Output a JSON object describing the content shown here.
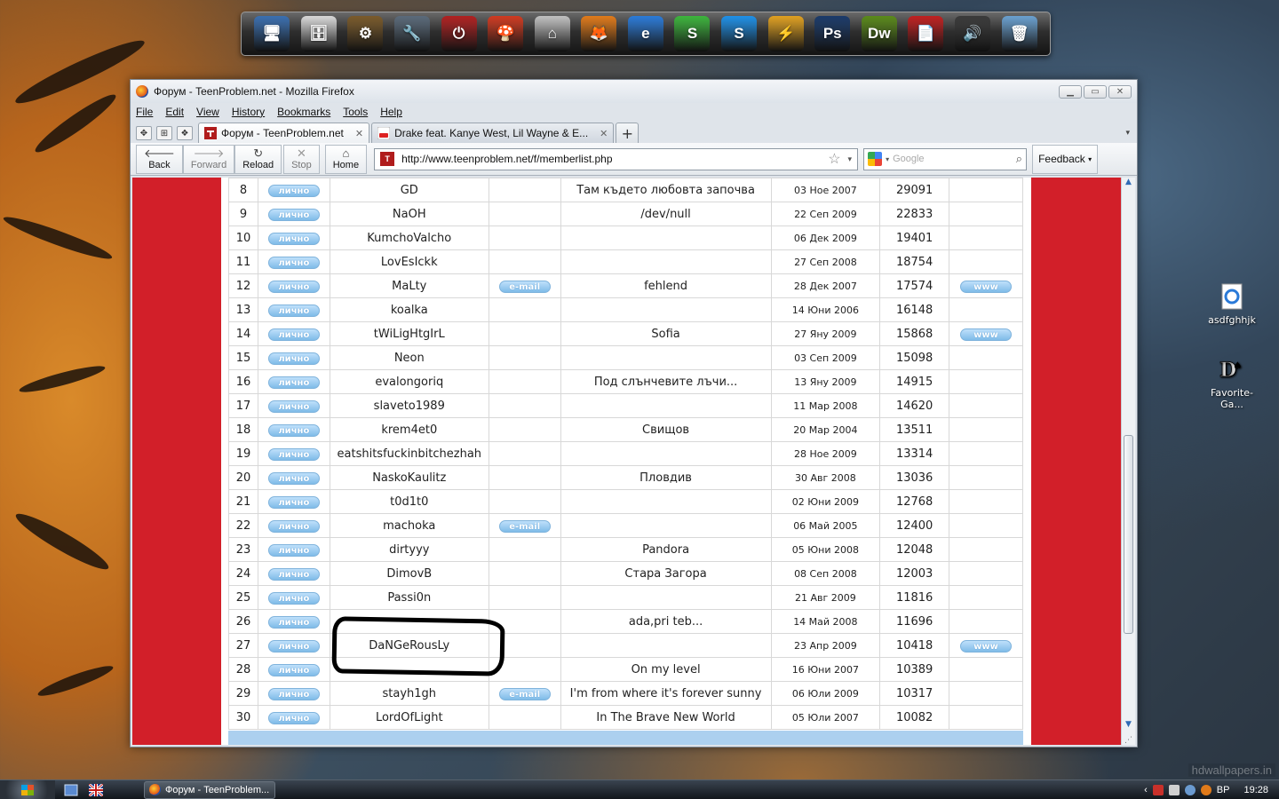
{
  "desktop": {
    "icons": [
      {
        "label": "asdfghhjk"
      },
      {
        "label": "Favorite-Ga..."
      }
    ],
    "watermark": "hdwallpapers.in"
  },
  "dock": {
    "items": [
      {
        "name": "computer-icon",
        "glyph": "🖥",
        "color": "#3a6fb0"
      },
      {
        "name": "file-cabinet-icon",
        "glyph": "🗄",
        "color": "#d8d8d8"
      },
      {
        "name": "tools-icon",
        "glyph": "⚙",
        "color": "#7a5a2a"
      },
      {
        "name": "network-icon",
        "glyph": "🔧",
        "color": "#5a6a7a"
      },
      {
        "name": "switch-icon",
        "glyph": "⏻",
        "color": "#b02020"
      },
      {
        "name": "mushroom-icon",
        "glyph": "🍄",
        "color": "#d03a20"
      },
      {
        "name": "house-icon",
        "glyph": "⌂",
        "color": "#c0c0c0"
      },
      {
        "name": "firefox-icon",
        "glyph": "🦊",
        "color": "#e07a1a"
      },
      {
        "name": "internet-explorer-icon",
        "glyph": "e",
        "color": "#2a7ad8"
      },
      {
        "name": "skype-green-icon",
        "glyph": "S",
        "color": "#3cb43c"
      },
      {
        "name": "skype-icon",
        "glyph": "S",
        "color": "#1e90e8"
      },
      {
        "name": "lightning-icon",
        "glyph": "⚡",
        "color": "#e0a020"
      },
      {
        "name": "photoshop-icon",
        "glyph": "Ps",
        "color": "#1a3a6a"
      },
      {
        "name": "dreamweaver-icon",
        "glyph": "Dw",
        "color": "#5a8a1a"
      },
      {
        "name": "pdf-icon",
        "glyph": "📄",
        "color": "#c02020"
      },
      {
        "name": "speakers-icon",
        "glyph": "🔊",
        "color": "#3a3a3a"
      },
      {
        "name": "recycle-bin-icon",
        "glyph": "🗑",
        "color": "#6aa0d0"
      }
    ]
  },
  "window": {
    "title": "Форум - TeenProblem.net - Mozilla Firefox",
    "menu": [
      "File",
      "Edit",
      "View",
      "History",
      "Bookmarks",
      "Tools",
      "Help"
    ],
    "tabs": [
      {
        "label": "Форум - TeenProblem.net",
        "active": true
      },
      {
        "label": "Drake feat. Kanye West, Lil Wayne & E...",
        "active": false
      }
    ],
    "nav": {
      "back": "Back",
      "forward": "Forward",
      "reload": "Reload",
      "stop": "Stop",
      "home": "Home",
      "feedback": "Feedback"
    },
    "url": "http://www.teenproblem.net/f/memberlist.php",
    "search_placeholder": "Google"
  },
  "members": {
    "pm_label": "лично",
    "email_label": "e-mail",
    "www_label": "www",
    "rows": [
      {
        "rank": "8",
        "user": "GD",
        "email": false,
        "location": "Там където любовта започва",
        "joined": "03 Ное 2007",
        "posts": "29091",
        "www": false
      },
      {
        "rank": "9",
        "user": "NaOH",
        "email": false,
        "location": "/dev/null",
        "joined": "22 Сеп 2009",
        "posts": "22833",
        "www": false
      },
      {
        "rank": "10",
        "user": "KumchoValcho",
        "email": false,
        "location": "",
        "joined": "06 Дек 2009",
        "posts": "19401",
        "www": false
      },
      {
        "rank": "11",
        "user": "LovEsIckk",
        "email": false,
        "location": "",
        "joined": "27 Сеп 2008",
        "posts": "18754",
        "www": false
      },
      {
        "rank": "12",
        "user": "MaLty",
        "email": true,
        "location": "fehlend",
        "joined": "28 Дек 2007",
        "posts": "17574",
        "www": true
      },
      {
        "rank": "13",
        "user": "koalka",
        "email": false,
        "location": "",
        "joined": "14 Юни 2006",
        "posts": "16148",
        "www": false
      },
      {
        "rank": "14",
        "user": "tWiLigHtgIrL",
        "email": false,
        "location": "Sofia",
        "joined": "27 Яну 2009",
        "posts": "15868",
        "www": true
      },
      {
        "rank": "15",
        "user": "Neon",
        "email": false,
        "location": "",
        "joined": "03 Сеп 2009",
        "posts": "15098",
        "www": false
      },
      {
        "rank": "16",
        "user": "evalongoriq",
        "email": false,
        "location": "Под слънчевите лъчи...",
        "joined": "13 Яну 2009",
        "posts": "14915",
        "www": false
      },
      {
        "rank": "17",
        "user": "slaveto1989",
        "email": false,
        "location": "",
        "joined": "11 Мар 2008",
        "posts": "14620",
        "www": false
      },
      {
        "rank": "18",
        "user": "krem4et0",
        "email": false,
        "location": "Свищов",
        "joined": "20 Мар 2004",
        "posts": "13511",
        "www": false
      },
      {
        "rank": "19",
        "user": "eatshitsfuckinbitchezhah",
        "email": false,
        "location": "",
        "joined": "28 Ное 2009",
        "posts": "13314",
        "www": false
      },
      {
        "rank": "20",
        "user": "NaskoKaulitz",
        "email": false,
        "location": "Пловдив",
        "joined": "30 Авг 2008",
        "posts": "13036",
        "www": false
      },
      {
        "rank": "21",
        "user": "t0d1t0",
        "email": false,
        "location": "",
        "joined": "02 Юни 2009",
        "posts": "12768",
        "www": false
      },
      {
        "rank": "22",
        "user": "machoka",
        "email": true,
        "location": "",
        "joined": "06 Май 2005",
        "posts": "12400",
        "www": false
      },
      {
        "rank": "23",
        "user": "dirtyyy",
        "email": false,
        "location": "Pandora",
        "joined": "05 Юни 2008",
        "posts": "12048",
        "www": false
      },
      {
        "rank": "24",
        "user": "DimovB",
        "email": false,
        "location": "Стара Загора",
        "joined": "08 Сеп 2008",
        "posts": "12003",
        "www": false
      },
      {
        "rank": "25",
        "user": "Passi0n",
        "email": false,
        "location": "",
        "joined": "21 Авг 2009",
        "posts": "11816",
        "www": false
      },
      {
        "rank": "26",
        "user": "",
        "email": false,
        "location": "ada,pri teb...",
        "joined": "14 Май 2008",
        "posts": "11696",
        "www": false
      },
      {
        "rank": "27",
        "user": "DaNGeRousLy",
        "email": false,
        "location": "",
        "joined": "23 Апр 2009",
        "posts": "10418",
        "www": true
      },
      {
        "rank": "28",
        "user": "",
        "email": false,
        "location": "On my level",
        "joined": "16 Юни 2007",
        "posts": "10389",
        "www": false
      },
      {
        "rank": "29",
        "user": "stayh1gh",
        "email": true,
        "location": "I'm from where it's forever sunny",
        "joined": "06 Юли 2009",
        "posts": "10317",
        "www": false
      },
      {
        "rank": "30",
        "user": "LordOfLight",
        "email": false,
        "location": "In The Brave New World",
        "joined": "05 Юли 2007",
        "posts": "10082",
        "www": false
      }
    ]
  },
  "taskbar": {
    "task_label": "Форум - TeenProblem...",
    "language": "BP",
    "clock": "19:28"
  }
}
